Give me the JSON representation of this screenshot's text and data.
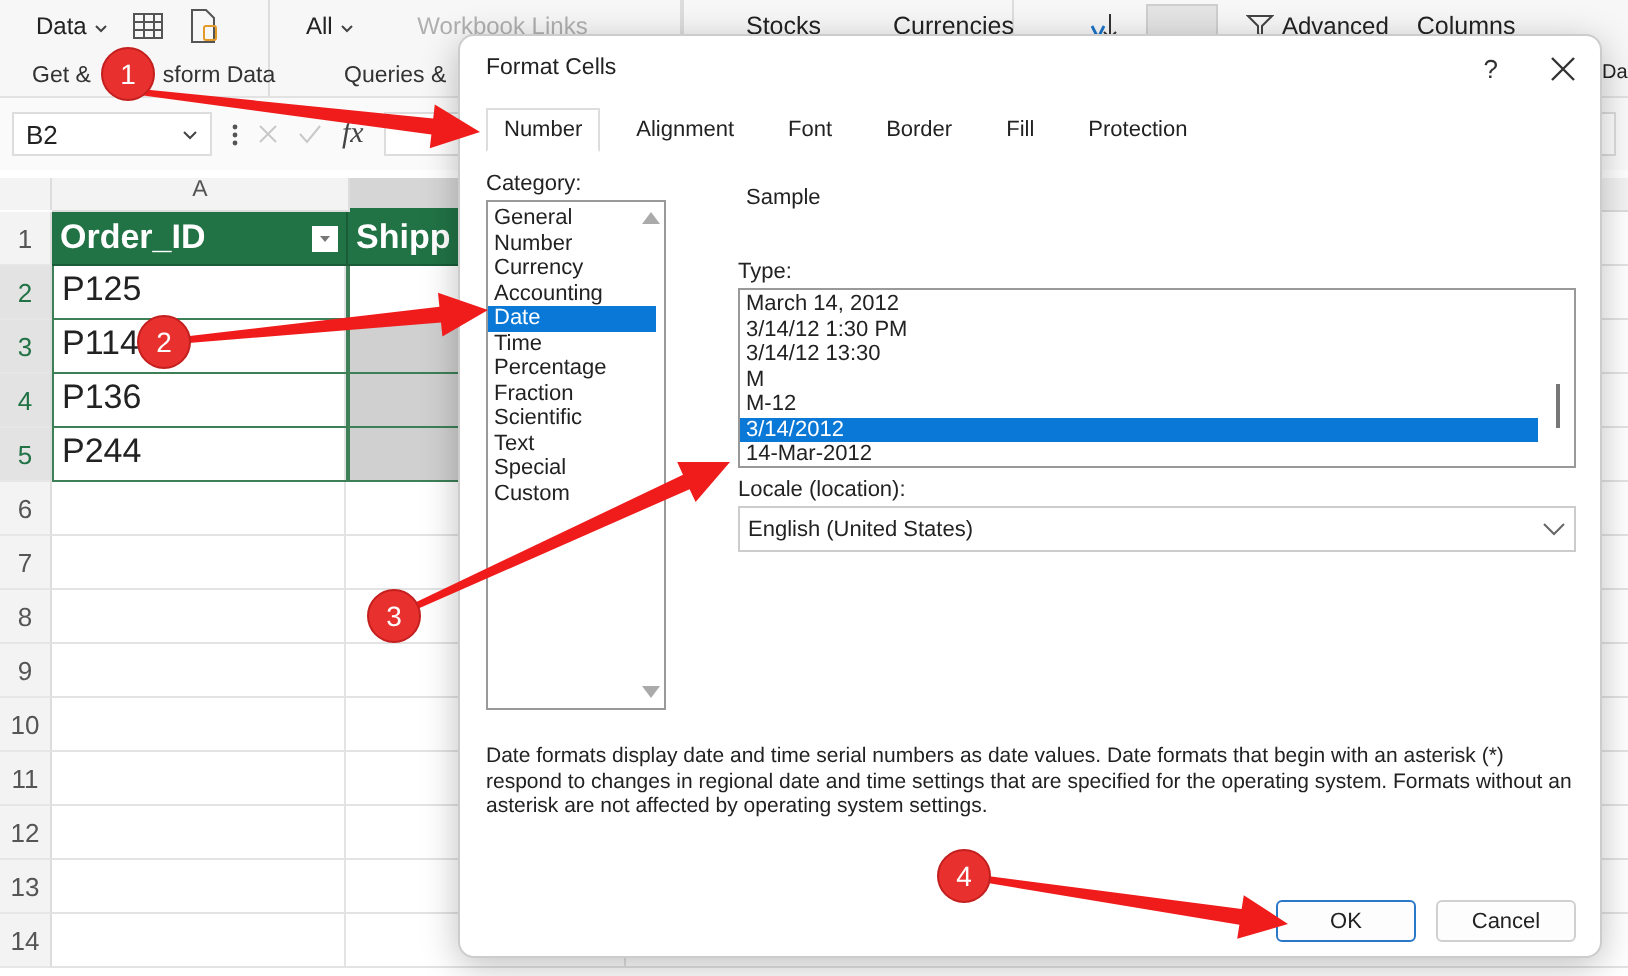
{
  "ribbon": {
    "data_button": "Data",
    "get_transform_label": [
      "Get &",
      "sform Data"
    ],
    "refresh_all_button": "All",
    "workbook_links": "Workbook Links",
    "queries_label": "Queries &",
    "stocks": "Stocks",
    "currencies": "Currencies",
    "advanced": "Advanced",
    "text_to_columns": "Columns",
    "cut_label": "Da"
  },
  "formula_bar": {
    "name_box": "B2",
    "function_symbol": "fx"
  },
  "sheet": {
    "columns": [
      {
        "label": "A",
        "selected": false
      },
      {
        "selected": true
      }
    ],
    "rows": [
      {
        "number": "1",
        "selected": false,
        "kind": "header",
        "cell_a": "Order_ID",
        "cell_b": "Shipp"
      },
      {
        "number": "2",
        "selected": true,
        "kind": "data",
        "cell_a": "P125",
        "cell_b_selected": true,
        "cell_b_active": true
      },
      {
        "number": "3",
        "selected": true,
        "kind": "data",
        "cell_a": "P114",
        "cell_b_selected": true,
        "cell_b_active": false
      },
      {
        "number": "4",
        "selected": true,
        "kind": "data",
        "cell_a": "P136",
        "cell_b_selected": true,
        "cell_b_active": false
      },
      {
        "number": "5",
        "selected": true,
        "kind": "data",
        "cell_a": "P244",
        "cell_b_selected": true,
        "cell_b_active": false
      },
      {
        "number": "6",
        "selected": false,
        "kind": "empty"
      },
      {
        "number": "7",
        "selected": false,
        "kind": "empty"
      },
      {
        "number": "8",
        "selected": false,
        "kind": "empty"
      },
      {
        "number": "9",
        "selected": false,
        "kind": "empty"
      },
      {
        "number": "10",
        "selected": false,
        "kind": "empty"
      },
      {
        "number": "11",
        "selected": false,
        "kind": "empty"
      },
      {
        "number": "12",
        "selected": false,
        "kind": "empty"
      },
      {
        "number": "13",
        "selected": false,
        "kind": "empty"
      },
      {
        "number": "14",
        "selected": false,
        "kind": "empty"
      }
    ]
  },
  "dialog": {
    "title": "Format Cells",
    "help": "?",
    "tabs": [
      {
        "label": "Number",
        "selected": true
      },
      {
        "label": "Alignment",
        "selected": false
      },
      {
        "label": "Font",
        "selected": false
      },
      {
        "label": "Border",
        "selected": false
      },
      {
        "label": "Fill",
        "selected": false
      },
      {
        "label": "Protection",
        "selected": false
      }
    ],
    "category_label": "Category:",
    "categories": [
      {
        "label": "General",
        "selected": false
      },
      {
        "label": "Number",
        "selected": false
      },
      {
        "label": "Currency",
        "selected": false
      },
      {
        "label": "Accounting",
        "selected": false
      },
      {
        "label": "Date",
        "selected": true
      },
      {
        "label": "Time",
        "selected": false
      },
      {
        "label": "Percentage",
        "selected": false
      },
      {
        "label": "Fraction",
        "selected": false
      },
      {
        "label": "Scientific",
        "selected": false
      },
      {
        "label": "Text",
        "selected": false
      },
      {
        "label": "Special",
        "selected": false
      },
      {
        "label": "Custom",
        "selected": false
      }
    ],
    "sample_label": "Sample",
    "type_label": "Type:",
    "types": [
      {
        "label": "March 14, 2012",
        "selected": false
      },
      {
        "label": "3/14/12 1:30 PM",
        "selected": false
      },
      {
        "label": "3/14/12 13:30",
        "selected": false
      },
      {
        "label": "M",
        "selected": false
      },
      {
        "label": "M-12",
        "selected": false
      },
      {
        "label": "3/14/2012",
        "selected": true
      },
      {
        "label": "14-Mar-2012",
        "selected": false
      }
    ],
    "locale_label": "Locale (location):",
    "locale_value": "English (United States)",
    "description": "Date formats display date and time serial numbers as date values.  Date formats that begin with an asterisk (*) respond to changes in regional date and time settings that are specified for the operating system. Formats without an asterisk are not affected by operating system settings.",
    "buttons": [
      {
        "label": "OK",
        "kind": "default"
      },
      {
        "label": "Cancel",
        "kind": "normal"
      }
    ]
  },
  "annotations": [
    {
      "label": "1"
    },
    {
      "label": "2"
    },
    {
      "label": "3"
    },
    {
      "label": "4"
    }
  ]
}
